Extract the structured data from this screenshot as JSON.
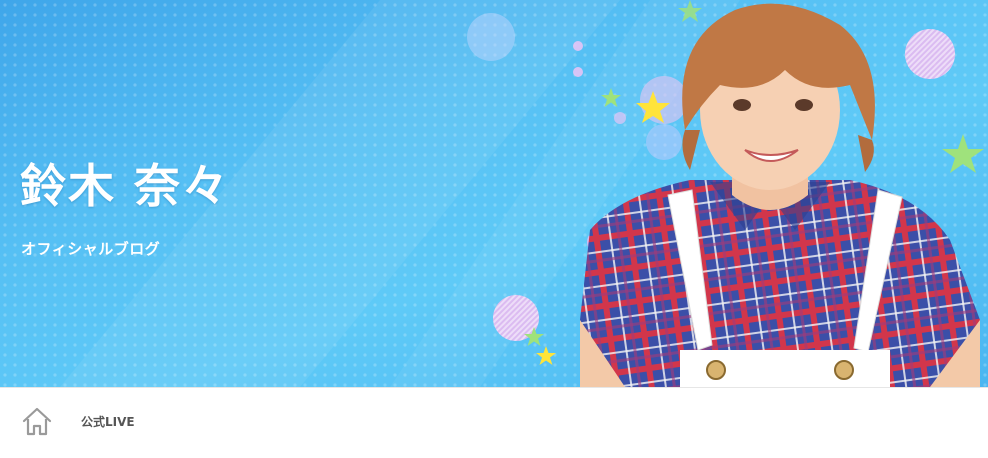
{
  "header": {
    "title": "鈴木 奈々",
    "subtitle": "オフィシャルブログ",
    "background_color": "#56c0f4",
    "accent_colors": [
      "#f2c2ea",
      "#ffe43a",
      "#a6e27a"
    ]
  },
  "nav": {
    "home_icon": "home-icon",
    "links": [
      {
        "label": "公式LIVE"
      }
    ]
  }
}
